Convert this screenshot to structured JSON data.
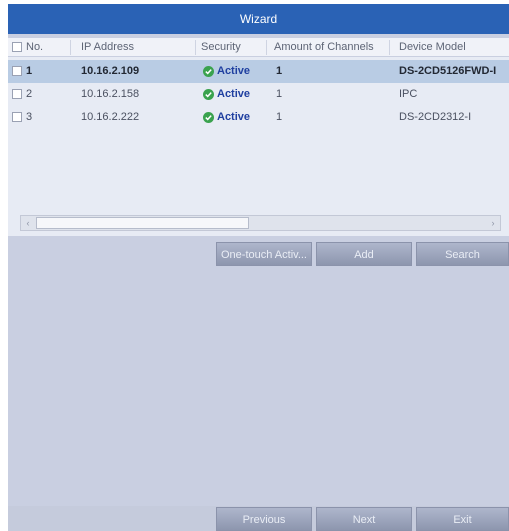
{
  "window": {
    "title": "Wizard"
  },
  "table": {
    "headers": [
      "No.",
      "IP Address",
      "Security",
      "Amount of Channels",
      "Device Model"
    ],
    "rows": [
      {
        "no": "1",
        "ip": "10.16.2.109",
        "security": "Active",
        "channels": "1",
        "model": "DS-2CD5126FWD-I",
        "selected": true
      },
      {
        "no": "2",
        "ip": "10.16.2.158",
        "security": "Active",
        "channels": "1",
        "model": "IPC",
        "selected": false
      },
      {
        "no": "3",
        "ip": "10.16.2.222",
        "security": "Active",
        "channels": "1",
        "model": "DS-2CD2312-I",
        "selected": false
      }
    ]
  },
  "actions": {
    "one_touch_label": "One-touch Activ...",
    "add_label": "Add",
    "search_label": "Search"
  },
  "footer": {
    "previous_label": "Previous",
    "next_label": "Next",
    "exit_label": "Exit"
  },
  "colors": {
    "title_bar": "#2a62b5",
    "selected_row": "#b9cce4",
    "active_text": "#1f3fa0",
    "active_icon": "#3aa24e"
  },
  "icons": {
    "active": "check-circle-icon",
    "scroll_left": "chevron-left-icon",
    "scroll_right": "chevron-right-icon"
  }
}
